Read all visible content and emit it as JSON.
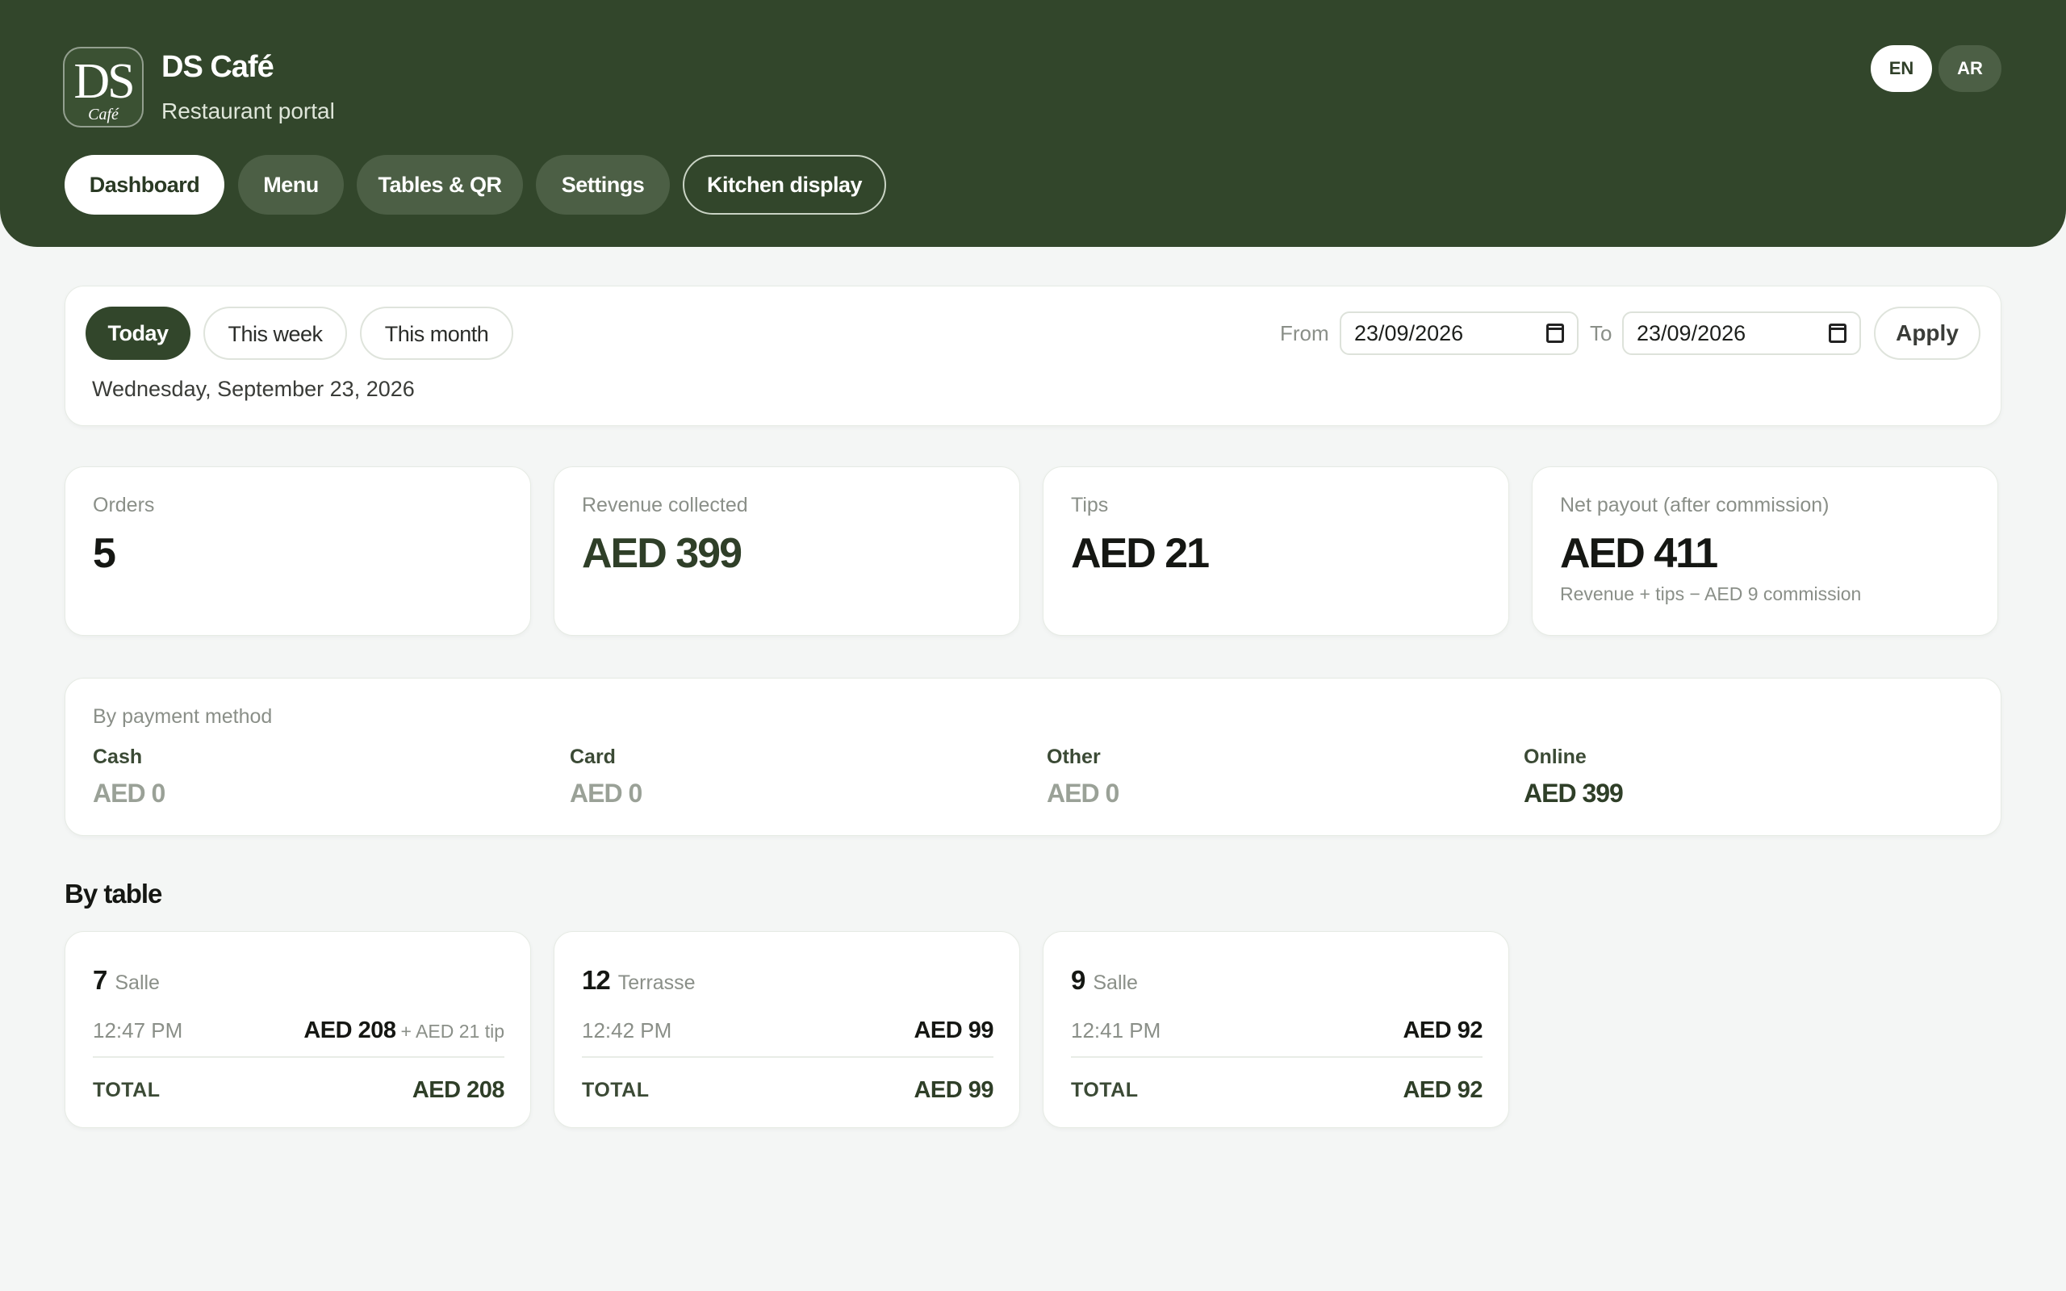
{
  "brand": {
    "logo_letters": "DS",
    "logo_script": "Café",
    "name": "DS Café",
    "subtitle": "Restaurant portal"
  },
  "languages": {
    "en": "EN",
    "ar": "AR",
    "active": "EN"
  },
  "nav": {
    "dashboard": "Dashboard",
    "menu": "Menu",
    "tables": "Tables & QR",
    "settings": "Settings",
    "kitchen": "Kitchen display",
    "active": "Dashboard"
  },
  "filters": {
    "today": "Today",
    "this_week": "This week",
    "this_month": "This month",
    "active": "Today",
    "current_date": "Wednesday, September 23, 2026",
    "from_label": "From",
    "from_value": "23/09/2026",
    "to_label": "To",
    "to_value": "23/09/2026",
    "apply": "Apply"
  },
  "stats": {
    "orders": {
      "label": "Orders",
      "value": "5"
    },
    "revenue": {
      "label": "Revenue collected",
      "value": "AED 399"
    },
    "tips": {
      "label": "Tips",
      "value": "AED 21"
    },
    "net": {
      "label": "Net payout (after commission)",
      "value": "AED 411",
      "note": "Revenue + tips − AED 9 commission"
    }
  },
  "payment": {
    "title": "By payment method",
    "methods": [
      {
        "label": "Cash",
        "amount": "AED 0"
      },
      {
        "label": "Card",
        "amount": "AED 0"
      },
      {
        "label": "Other",
        "amount": "AED 0"
      },
      {
        "label": "Online",
        "amount": "AED 399"
      }
    ]
  },
  "by_table": {
    "title": "By table",
    "tables": [
      {
        "number": "7",
        "zone": "Salle",
        "time": "12:47 PM",
        "amount": "AED 208",
        "tip": "+ AED 21 tip",
        "total_label": "TOTAL",
        "total": "AED 208"
      },
      {
        "number": "12",
        "zone": "Terrasse",
        "time": "12:42 PM",
        "amount": "AED 99",
        "tip": "",
        "total_label": "TOTAL",
        "total": "AED 99"
      },
      {
        "number": "9",
        "zone": "Salle",
        "time": "12:41 PM",
        "amount": "AED 92",
        "tip": "",
        "total_label": "TOTAL",
        "total": "AED 92"
      }
    ]
  },
  "colors": {
    "brand_green": "#32462b",
    "background": "#f4f6f5",
    "card": "#ffffff",
    "muted_text": "#8a8f88"
  },
  "icons": {
    "date_picker": "calendar-icon"
  }
}
